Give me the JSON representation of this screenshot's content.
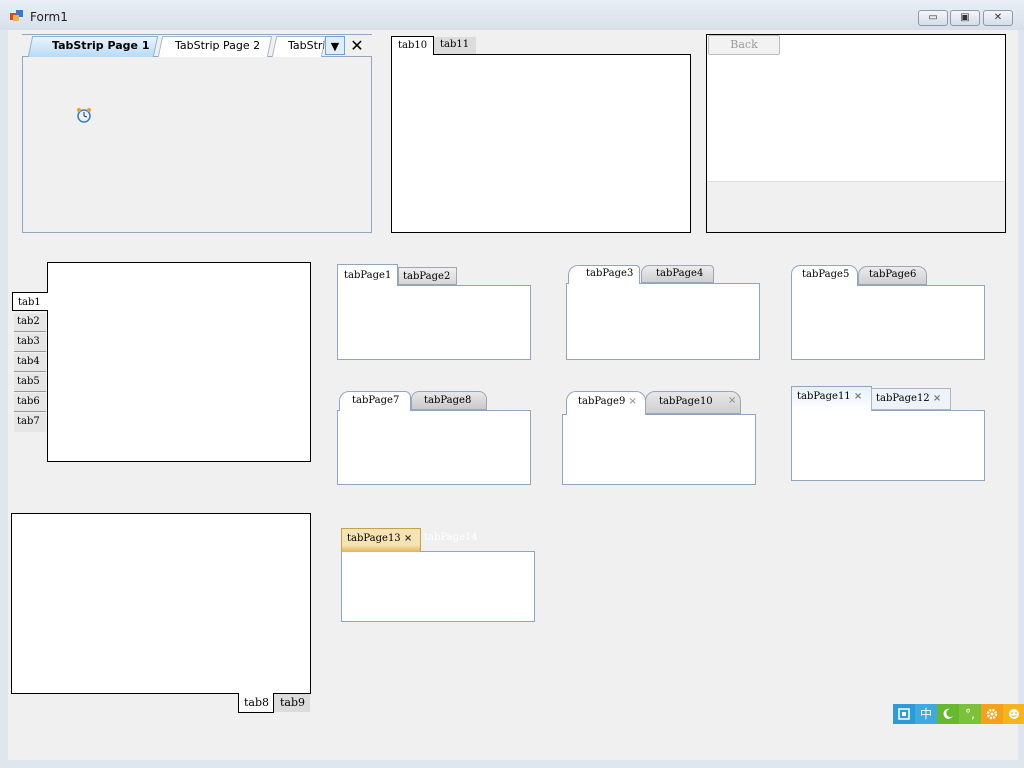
{
  "window": {
    "title": "Form1",
    "minimize": "▭",
    "maximize": "▣",
    "close": "✕"
  },
  "tabstrip": {
    "tabs": [
      "TabStrip Page 1",
      "TabStrip Page 2",
      "TabStri"
    ],
    "dropdown": "▼",
    "close": "✕"
  },
  "panel_a": {
    "tabs": [
      "tab10",
      "tab11"
    ]
  },
  "browser": {
    "back": "Back"
  },
  "side_tabs": [
    "tab1",
    "tab2",
    "tab3",
    "tab4",
    "tab5",
    "tab6",
    "tab7"
  ],
  "bottom_tabs": [
    "tab8",
    "tab9"
  ],
  "tc1": [
    "tabPage1",
    "tabPage2"
  ],
  "tc2": [
    "tabPage3",
    "tabPage4"
  ],
  "tc3": [
    "tabPage5",
    "tabPage6"
  ],
  "tc4": [
    "tabPage7",
    "tabPage8"
  ],
  "tc5": [
    "tabPage9",
    "tabPage10"
  ],
  "tc6": [
    "tabPage11",
    "tabPage12"
  ],
  "tc7": [
    "tabPage13",
    "tabPage14"
  ],
  "close_glyph": "×",
  "ime": {
    "items": [
      "中"
    ],
    "colors": [
      "#2f9bd6",
      "#41a8e0",
      "#66b82e",
      "#7cc13a",
      "#f5a11a",
      "#f7b51c"
    ]
  }
}
